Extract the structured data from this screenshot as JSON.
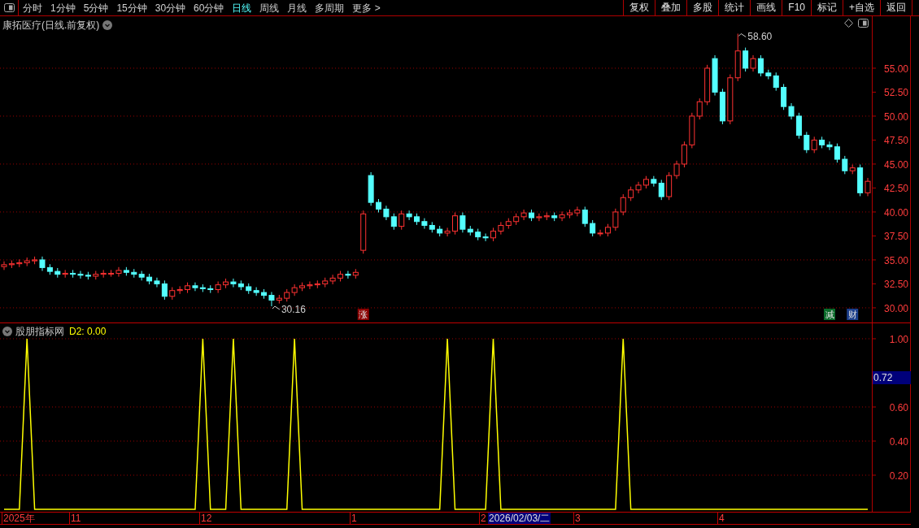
{
  "toolbar": {
    "periods": [
      {
        "label": "分时",
        "selected": false
      },
      {
        "label": "1分钟",
        "selected": false
      },
      {
        "label": "5分钟",
        "selected": false
      },
      {
        "label": "15分钟",
        "selected": false
      },
      {
        "label": "30分钟",
        "selected": false
      },
      {
        "label": "60分钟",
        "selected": false
      },
      {
        "label": "日线",
        "selected": true
      },
      {
        "label": "周线",
        "selected": false
      },
      {
        "label": "月线",
        "selected": false
      },
      {
        "label": "多周期",
        "selected": false
      },
      {
        "label": "更多 >",
        "selected": false
      }
    ],
    "actions": [
      "复权",
      "叠加",
      "多股",
      "统计",
      "画线",
      "F10",
      "标记",
      "+自选",
      "返回"
    ]
  },
  "main_chart": {
    "title": "康拓医疗(日线.前复权)",
    "high_label": "58.60",
    "low_label": "30.16",
    "markers": [
      {
        "label": "涨",
        "color": "#8b0000"
      },
      {
        "label": "减",
        "color": "#0a6b2a"
      },
      {
        "label": "财",
        "color": "#1c3f8c"
      }
    ],
    "chart_data": {
      "type": "candlestick",
      "grid": true,
      "ylim": [
        28.47,
        60.42
      ],
      "yticks": [
        {
          "value": 55,
          "label": "55.00"
        },
        {
          "value": 52.5,
          "label": "52.50"
        },
        {
          "value": 50,
          "label": "50.00"
        },
        {
          "value": 47.5,
          "label": "47.50"
        },
        {
          "value": 45,
          "label": "45.00"
        },
        {
          "value": 42.5,
          "label": "42.50"
        },
        {
          "value": 40,
          "label": "40.00"
        },
        {
          "value": 37.5,
          "label": "37.50"
        },
        {
          "value": 35,
          "label": "35.00"
        },
        {
          "value": 32.5,
          "label": "32.50"
        },
        {
          "value": 30,
          "label": "30.00"
        }
      ],
      "ohlc": [
        [
          34.3,
          34.85,
          33.95,
          34.5
        ],
        [
          34.5,
          34.95,
          34.15,
          34.6
        ],
        [
          34.6,
          35.05,
          34.25,
          34.7
        ],
        [
          34.7,
          35.25,
          34.35,
          34.9
        ],
        [
          34.9,
          35.35,
          34.55,
          35.0
        ],
        [
          35.0,
          35.35,
          33.85,
          34.2
        ],
        [
          34.2,
          34.55,
          33.45,
          33.8
        ],
        [
          33.8,
          34.15,
          33.15,
          33.5
        ],
        [
          33.5,
          33.95,
          33.15,
          33.6
        ],
        [
          33.6,
          33.95,
          33.15,
          33.5
        ],
        [
          33.5,
          33.85,
          33.05,
          33.4
        ],
        [
          33.4,
          33.75,
          32.95,
          33.3
        ],
        [
          33.3,
          33.85,
          32.95,
          33.5
        ],
        [
          33.5,
          33.95,
          33.15,
          33.6
        ],
        [
          33.6,
          33.95,
          33.25,
          33.6
        ],
        [
          33.6,
          34.25,
          33.25,
          33.9
        ],
        [
          33.9,
          34.25,
          33.35,
          33.7
        ],
        [
          33.7,
          34.05,
          33.15,
          33.5
        ],
        [
          33.5,
          33.85,
          32.85,
          33.2
        ],
        [
          33.2,
          33.55,
          32.45,
          32.8
        ],
        [
          32.8,
          33.15,
          32.15,
          32.5
        ],
        [
          32.5,
          32.85,
          30.85,
          31.2
        ],
        [
          31.2,
          32.15,
          30.85,
          31.8
        ],
        [
          31.8,
          32.25,
          31.45,
          31.9
        ],
        [
          31.9,
          32.65,
          31.55,
          32.3
        ],
        [
          32.3,
          32.65,
          31.75,
          32.1
        ],
        [
          32.1,
          32.45,
          31.65,
          32.0
        ],
        [
          32.0,
          32.35,
          31.55,
          31.9
        ],
        [
          31.9,
          32.75,
          31.55,
          32.4
        ],
        [
          32.4,
          33.05,
          32.05,
          32.7
        ],
        [
          32.7,
          33.05,
          32.15,
          32.5
        ],
        [
          32.5,
          32.85,
          31.85,
          32.2
        ],
        [
          32.2,
          32.55,
          31.45,
          31.8
        ],
        [
          31.8,
          32.15,
          31.25,
          31.6
        ],
        [
          31.6,
          31.95,
          30.95,
          31.3
        ],
        [
          31.3,
          31.65,
          30.16,
          30.8
        ],
        [
          30.8,
          31.35,
          30.45,
          31.0
        ],
        [
          31.0,
          31.95,
          30.65,
          31.6
        ],
        [
          31.6,
          32.45,
          31.25,
          32.1
        ],
        [
          32.1,
          32.65,
          31.75,
          32.3
        ],
        [
          32.3,
          32.75,
          31.95,
          32.4
        ],
        [
          32.4,
          32.85,
          32.05,
          32.5
        ],
        [
          32.5,
          33.15,
          32.15,
          32.8
        ],
        [
          32.8,
          33.45,
          32.45,
          33.1
        ],
        [
          33.1,
          33.85,
          32.75,
          33.5
        ],
        [
          33.5,
          33.85,
          33.05,
          33.4
        ],
        [
          33.4,
          34.05,
          33.05,
          33.7
        ],
        [
          36.0,
          40.15,
          35.65,
          39.8
        ],
        [
          43.8,
          44.15,
          40.65,
          41.0
        ],
        [
          41.0,
          41.35,
          39.95,
          40.3
        ],
        [
          40.3,
          40.65,
          39.15,
          39.5
        ],
        [
          39.5,
          39.85,
          38.15,
          38.5
        ],
        [
          38.5,
          40.15,
          38.15,
          39.8
        ],
        [
          39.8,
          40.15,
          39.15,
          39.5
        ],
        [
          39.5,
          39.85,
          38.65,
          39.0
        ],
        [
          39.0,
          39.35,
          38.25,
          38.6
        ],
        [
          38.6,
          38.95,
          37.85,
          38.2
        ],
        [
          38.2,
          38.55,
          37.45,
          37.8
        ],
        [
          37.8,
          38.35,
          37.45,
          38.0
        ],
        [
          38.0,
          39.95,
          37.65,
          39.6
        ],
        [
          39.6,
          39.95,
          37.85,
          38.2
        ],
        [
          38.2,
          38.55,
          37.55,
          37.9
        ],
        [
          37.9,
          38.25,
          37.05,
          37.4
        ],
        [
          37.4,
          37.75,
          36.95,
          37.3
        ],
        [
          37.3,
          38.35,
          36.95,
          38.0
        ],
        [
          38.0,
          38.95,
          37.65,
          38.6
        ],
        [
          38.6,
          39.35,
          38.25,
          39.0
        ],
        [
          39.0,
          39.85,
          38.65,
          39.5
        ],
        [
          39.5,
          40.25,
          39.15,
          39.9
        ],
        [
          39.9,
          40.25,
          39.05,
          39.4
        ],
        [
          39.4,
          39.85,
          39.05,
          39.5
        ],
        [
          39.5,
          39.95,
          39.15,
          39.6
        ],
        [
          39.6,
          39.95,
          39.05,
          39.4
        ],
        [
          39.4,
          40.05,
          39.05,
          39.7
        ],
        [
          39.7,
          40.25,
          39.35,
          39.9
        ],
        [
          39.9,
          40.55,
          39.55,
          40.2
        ],
        [
          40.2,
          40.55,
          38.45,
          38.8
        ],
        [
          38.8,
          39.15,
          37.45,
          37.8
        ],
        [
          37.8,
          38.15,
          37.45,
          37.8
        ],
        [
          37.8,
          38.75,
          37.45,
          38.4
        ],
        [
          38.4,
          40.35,
          38.05,
          40.0
        ],
        [
          40.0,
          41.85,
          39.65,
          41.5
        ],
        [
          41.5,
          42.65,
          41.15,
          42.3
        ],
        [
          42.3,
          43.15,
          41.95,
          42.8
        ],
        [
          42.8,
          43.75,
          42.45,
          43.4
        ],
        [
          43.4,
          43.75,
          42.65,
          43.0
        ],
        [
          43.0,
          43.35,
          41.25,
          41.6
        ],
        [
          41.6,
          44.15,
          41.25,
          43.8
        ],
        [
          43.8,
          45.35,
          43.45,
          45.0
        ],
        [
          45.0,
          47.35,
          44.65,
          47.0
        ],
        [
          47.0,
          50.35,
          46.65,
          50.0
        ],
        [
          50.0,
          51.85,
          49.65,
          51.5
        ],
        [
          51.5,
          55.35,
          51.15,
          55.0
        ],
        [
          56.0,
          56.35,
          52.15,
          52.5
        ],
        [
          52.5,
          52.85,
          49.15,
          49.5
        ],
        [
          49.5,
          54.35,
          49.15,
          54.0
        ],
        [
          54.0,
          58.6,
          53.65,
          56.8
        ],
        [
          56.8,
          57.15,
          54.65,
          55.0
        ],
        [
          55.0,
          56.35,
          54.65,
          56.0
        ],
        [
          56.0,
          56.35,
          54.15,
          54.5
        ],
        [
          54.5,
          54.85,
          53.85,
          54.2
        ],
        [
          54.2,
          54.55,
          52.65,
          53.0
        ],
        [
          53.0,
          53.35,
          50.65,
          51.0
        ],
        [
          51.0,
          51.35,
          49.65,
          50.0
        ],
        [
          50.0,
          50.35,
          47.65,
          48.0
        ],
        [
          48.0,
          48.35,
          46.15,
          46.5
        ],
        [
          46.5,
          47.85,
          46.15,
          47.5
        ],
        [
          47.5,
          47.85,
          46.65,
          47.0
        ],
        [
          47.0,
          47.35,
          46.45,
          46.8
        ],
        [
          46.8,
          47.15,
          45.15,
          45.5
        ],
        [
          45.5,
          45.85,
          43.95,
          44.3
        ],
        [
          44.3,
          44.95,
          43.95,
          44.6
        ],
        [
          44.6,
          44.95,
          41.65,
          42.0
        ],
        [
          42.0,
          43.55,
          41.65,
          43.2
        ]
      ]
    }
  },
  "indicator": {
    "name": "股朋指标网",
    "readout_value": ": 0.00",
    "cursor_value": "0.72",
    "chart_data": {
      "type": "line",
      "grid": true,
      "ylim": [
        -0.0143,
        1.0905
      ],
      "yticks": [
        {
          "value": 0.2,
          "label": "0.20"
        },
        {
          "value": 0.4,
          "label": "0.40"
        },
        {
          "value": 0.6,
          "label": "0.60"
        },
        {
          "value": 1,
          "label": "1.00"
        }
      ],
      "series": [
        {
          "name": "D2",
          "color": "#ffff00",
          "values": [
            0,
            0,
            0,
            1,
            0,
            0,
            0,
            0,
            0,
            0,
            0,
            0,
            0,
            0,
            0,
            0,
            0,
            0,
            0,
            0,
            0,
            0,
            0,
            0,
            0,
            0,
            1,
            0,
            0,
            0,
            1,
            0,
            0,
            0,
            0,
            0,
            0,
            0,
            1,
            0,
            0,
            0,
            0,
            0,
            0,
            0,
            0,
            0,
            0,
            0,
            0,
            0,
            0,
            0,
            0,
            0,
            0,
            0,
            1,
            0,
            0,
            0,
            0,
            0,
            1,
            0,
            0,
            0,
            0,
            0,
            0,
            0,
            0,
            0,
            0,
            0,
            0,
            0,
            0,
            0,
            0,
            1,
            0,
            0,
            0,
            0,
            0,
            0,
            0,
            0,
            0,
            0,
            0,
            0,
            0,
            0,
            0,
            0,
            0,
            0,
            0,
            0,
            0,
            0,
            0,
            0,
            0,
            0,
            0,
            0,
            0,
            0,
            0,
            0
          ]
        }
      ]
    }
  },
  "date_axis": {
    "labels": [
      "2025年",
      "11",
      "12",
      "1",
      "2",
      "3",
      "4"
    ],
    "cursor_date": "2026/02/03/二"
  }
}
